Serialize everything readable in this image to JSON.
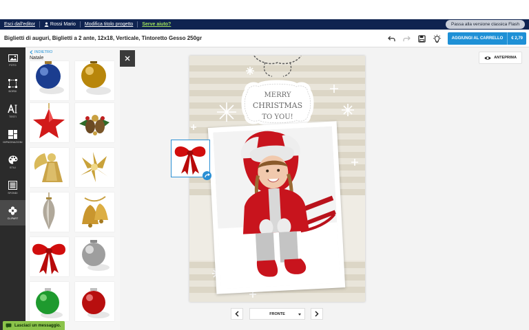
{
  "nav": {
    "exit_label": "Esci dall'editor",
    "user_name": "Rossi Mario",
    "edit_title_label": "Modifica titolo progetto",
    "help_label": "Serve aiuto?",
    "flash_label": "Passa alla versione classica Flash"
  },
  "product": {
    "title": "Biglietti di auguri, Biglietti a 2 ante, 12x18, Verticale, Tintoretto Gesso 250gr"
  },
  "toolbar": {
    "add_to_cart_label": "AGGIUNGI AL CARRELLO",
    "price": "€ 2,79"
  },
  "sidebar": {
    "items": [
      {
        "label": "FOTO",
        "icon": "image-icon"
      },
      {
        "label": "BORDI",
        "icon": "frame-icon"
      },
      {
        "label": "TESTI",
        "icon": "text-icon"
      },
      {
        "label": "IMPAGINAZIONI",
        "icon": "layout-icon"
      },
      {
        "label": "STILI",
        "icon": "palette-icon"
      },
      {
        "label": "SFONDI",
        "icon": "background-icon"
      },
      {
        "label": "CLIPART",
        "icon": "clipart-icon"
      }
    ]
  },
  "panel": {
    "back_label": "INDIETRO",
    "category": "Natale"
  },
  "canvas": {
    "preview_label": "ANTEPRIMA",
    "card_text": [
      "MERRY",
      "CHRISTMAS",
      "TO YOU!"
    ],
    "page_selected": "FRONTE"
  },
  "chat": {
    "label": "Lasciaci un messaggio."
  },
  "colors": {
    "navy": "#0f2350",
    "accent_blue": "#1e90d6",
    "help_green": "#9fe05b",
    "sidebar_dark": "#2b2b2b",
    "chat_green": "#8bc34a"
  }
}
